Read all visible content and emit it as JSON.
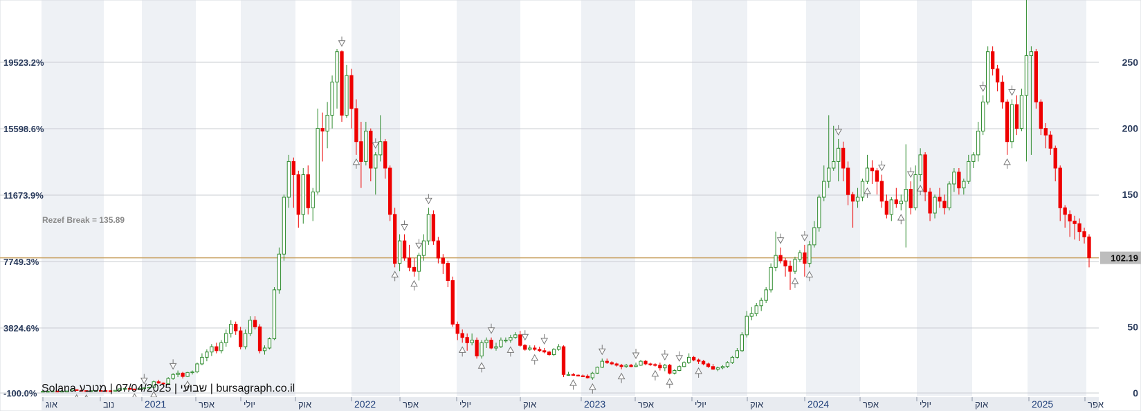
{
  "colors": {
    "up": "#2e8b2e",
    "down": "#ee0000",
    "price_line": "#c8a060",
    "grid": "#c9ccd2",
    "band": "#eef1f5",
    "axis_text": "#2a3b5c",
    "marker": "#777777",
    "price_box": "#bdbdbd"
  },
  "footer": "Solana שבועי | 07/04/2025 | מטבע | bursagraph.co.il",
  "annotation": "Rezef Break = 135.89",
  "last_price_label": "102.19",
  "chart_data": {
    "type": "candlestick",
    "title": "",
    "xlabel": "",
    "ylabel": "",
    "x_tick_labels": [
      "אוג",
      "נוב",
      "2021",
      "אפר",
      "יולי",
      "אוק",
      "2022",
      "אפר",
      "יולי",
      "אוק",
      "2023",
      "אפר",
      "יולי",
      "אוק",
      "2024",
      "אפר",
      "יולי",
      "אוק",
      "2025",
      "אפר"
    ],
    "left_axis_percent": [
      "19523.2%",
      "15598.6%",
      "11673.9%",
      "7749.3%",
      "3824.6%",
      "-100.0%"
    ],
    "right_axis_ticks": [
      "250",
      "200",
      "150",
      "50",
      "0"
    ],
    "ylim": [
      0,
      295
    ],
    "horizontal_line": 102.19,
    "grid": true,
    "candles": [
      [
        1.3,
        1.3,
        1.2,
        1.3
      ],
      [
        1.3,
        1.4,
        1.2,
        1.3
      ],
      [
        1.3,
        1.6,
        1.2,
        1.5
      ],
      [
        1.5,
        1.6,
        1.3,
        1.4
      ],
      [
        1.4,
        1.5,
        1.3,
        1.4
      ],
      [
        1.4,
        1.5,
        1.3,
        1.5
      ],
      [
        1.5,
        2.7,
        1.4,
        2.5
      ],
      [
        2.5,
        2.7,
        1.8,
        2.0
      ],
      [
        2.0,
        2.2,
        1.5,
        1.8
      ],
      [
        1.8,
        2.0,
        1.6,
        1.7
      ],
      [
        1.7,
        1.9,
        1.5,
        1.7
      ],
      [
        1.7,
        2.0,
        1.6,
        1.9
      ],
      [
        1.9,
        2.1,
        1.6,
        1.8
      ],
      [
        1.8,
        2.0,
        1.5,
        1.7
      ],
      [
        1.7,
        1.9,
        1.5,
        1.6
      ],
      [
        1.6,
        2.2,
        1.5,
        2.0
      ],
      [
        2.0,
        3.5,
        1.9,
        3.2
      ],
      [
        3.2,
        4.0,
        3.0,
        3.5
      ],
      [
        3.5,
        3.7,
        2.8,
        3.0
      ],
      [
        3.0,
        3.2,
        2.5,
        2.8
      ],
      [
        2.8,
        3.5,
        2.6,
        3.3
      ],
      [
        3.3,
        4.0,
        3.2,
        3.9
      ],
      [
        3.9,
        4.6,
        3.6,
        4.4
      ],
      [
        4.4,
        9.5,
        4.2,
        8.5
      ],
      [
        8.5,
        10.0,
        7.0,
        7.5
      ],
      [
        7.5,
        8.0,
        6.0,
        7.0
      ],
      [
        7.0,
        12.0,
        6.8,
        11.0
      ],
      [
        11.0,
        15.0,
        10.0,
        14.0
      ],
      [
        14.0,
        17.0,
        12.0,
        15.0
      ],
      [
        15.0,
        16.0,
        11.0,
        12.5
      ],
      [
        12.5,
        16.0,
        12.0,
        15.5
      ],
      [
        15.5,
        17.0,
        14.0,
        16.0
      ],
      [
        16.0,
        23.0,
        15.0,
        22.0
      ],
      [
        22.0,
        30.0,
        21.0,
        27.0
      ],
      [
        27.0,
        33.0,
        24.0,
        31.0
      ],
      [
        31.0,
        37.0,
        28.0,
        35.0
      ],
      [
        35.0,
        38.0,
        30.0,
        32.0
      ],
      [
        32.0,
        40.0,
        30.0,
        38.0
      ],
      [
        38.0,
        48.0,
        35.0,
        45.0
      ],
      [
        45.0,
        55.0,
        42.0,
        52.0
      ],
      [
        52.0,
        54.0,
        44.0,
        47.0
      ],
      [
        47.0,
        50.0,
        33.0,
        35.0
      ],
      [
        35.0,
        48.0,
        33.0,
        45.0
      ],
      [
        45.0,
        58.0,
        43.0,
        55.0
      ],
      [
        55.0,
        58.0,
        48.0,
        50.0
      ],
      [
        50.0,
        52.0,
        30.0,
        32.0
      ],
      [
        32.0,
        36.0,
        29.0,
        34.0
      ],
      [
        34.0,
        42.0,
        33.0,
        41.0
      ],
      [
        41.0,
        80.0,
        40.0,
        78.0
      ],
      [
        78.0,
        110.0,
        75.0,
        105.0
      ],
      [
        105.0,
        150.0,
        100.0,
        148.0
      ],
      [
        148.0,
        180.0,
        140.0,
        175.0
      ],
      [
        175.0,
        178.0,
        140.0,
        165.0
      ],
      [
        165.0,
        168.0,
        125.0,
        135.0
      ],
      [
        135.0,
        170.0,
        128.0,
        165.0
      ],
      [
        165.0,
        172.0,
        135.0,
        140.0
      ],
      [
        140.0,
        155.0,
        130.0,
        152.0
      ],
      [
        152.0,
        215.0,
        150.0,
        200.0
      ],
      [
        200.0,
        212.0,
        175.0,
        198.0
      ],
      [
        198.0,
        220.0,
        185.0,
        210.0
      ],
      [
        210.0,
        240.0,
        200.0,
        235.0
      ],
      [
        235.0,
        260.0,
        215.0,
        258.0
      ],
      [
        258.0,
        259.0,
        205.0,
        210.0
      ],
      [
        210.0,
        248.0,
        208.0,
        240.0
      ],
      [
        240.0,
        245.0,
        200.0,
        215.0
      ],
      [
        215.0,
        222.0,
        180.0,
        190.0
      ],
      [
        190.0,
        205.0,
        155.0,
        175.0
      ],
      [
        175.0,
        205.0,
        172.0,
        198.0
      ],
      [
        198.0,
        200.0,
        160.0,
        170.0
      ],
      [
        170.0,
        182.0,
        150.0,
        180.0
      ],
      [
        180.0,
        210.0,
        175.0,
        190.0
      ],
      [
        190.0,
        192.0,
        162.0,
        170.0
      ],
      [
        170.0,
        172.0,
        130.0,
        135.0
      ],
      [
        135.0,
        140.0,
        95.0,
        98.0
      ],
      [
        98.0,
        120.0,
        92.0,
        115.0
      ],
      [
        115.0,
        120.0,
        100.0,
        102.0
      ],
      [
        102.0,
        112.0,
        92.0,
        95.0
      ],
      [
        95.0,
        102.0,
        88.0,
        92.0
      ],
      [
        92.0,
        106.0,
        85.0,
        104.0
      ],
      [
        104.0,
        120.0,
        100.0,
        115.0
      ],
      [
        115.0,
        140.0,
        112.0,
        135.0
      ],
      [
        135.0,
        138.0,
        112.0,
        115.0
      ],
      [
        115.0,
        118.0,
        98.0,
        102.0
      ],
      [
        102.0,
        105.0,
        90.0,
        98.0
      ],
      [
        98.0,
        100.0,
        80.0,
        85.0
      ],
      [
        85.0,
        88.0,
        50.0,
        52.0
      ],
      [
        52.0,
        54.0,
        40.0,
        45.0
      ],
      [
        45.0,
        48.0,
        38.0,
        42.0
      ],
      [
        42.0,
        45.0,
        32.0,
        38.0
      ],
      [
        38.0,
        45.0,
        36.0,
        40.0
      ],
      [
        40.0,
        42.0,
        26.0,
        28.0
      ],
      [
        28.0,
        40.0,
        26.0,
        38.0
      ],
      [
        38.0,
        42.0,
        34.0,
        40.0
      ],
      [
        40.0,
        42.0,
        33.0,
        34.0
      ],
      [
        34.0,
        38.0,
        32.0,
        35.0
      ],
      [
        35.0,
        42.0,
        34.0,
        40.0
      ],
      [
        40.0,
        42.0,
        38.0,
        40.0
      ],
      [
        40.0,
        44.0,
        38.0,
        42.0
      ],
      [
        42.0,
        46.0,
        41.0,
        44.0
      ],
      [
        44.0,
        47.0,
        35.0,
        36.0
      ],
      [
        36.0,
        37.0,
        32.0,
        33.0
      ],
      [
        33.0,
        36.0,
        32.0,
        34.0
      ],
      [
        34.0,
        36.0,
        32.0,
        33.0
      ],
      [
        33.0,
        35.0,
        31.0,
        32.0
      ],
      [
        32.0,
        34.0,
        30.0,
        31.0
      ],
      [
        31.0,
        32.0,
        28.0,
        29.0
      ],
      [
        29.0,
        34.0,
        28.0,
        33.0
      ],
      [
        33.0,
        37.0,
        32.0,
        35.0
      ],
      [
        35.0,
        36.0,
        12.0,
        14.0
      ],
      [
        14.0,
        16.0,
        13.0,
        14.0
      ],
      [
        14.0,
        15.0,
        13.0,
        13.5
      ],
      [
        13.5,
        14.0,
        12.5,
        13.0
      ],
      [
        13.0,
        14.0,
        12.0,
        12.8
      ],
      [
        12.8,
        14.0,
        11.0,
        11.5
      ],
      [
        11.5,
        16.0,
        10.0,
        15.0
      ],
      [
        15.0,
        20.0,
        14.5,
        19.5
      ],
      [
        19.5,
        26.0,
        19.0,
        24.0
      ],
      [
        24.0,
        26.0,
        22.0,
        23.0
      ],
      [
        23.0,
        24.0,
        21.0,
        22.0
      ],
      [
        22.0,
        23.0,
        20.0,
        21.0
      ],
      [
        21.0,
        22.0,
        18.0,
        20.0
      ],
      [
        20.0,
        22.0,
        19.0,
        21.0
      ],
      [
        21.0,
        22.0,
        19.5,
        20.0
      ],
      [
        20.0,
        23.0,
        19.5,
        21.0
      ],
      [
        21.0,
        25.0,
        20.5,
        24.0
      ],
      [
        24.0,
        25.0,
        21.0,
        22.0
      ],
      [
        22.0,
        23.0,
        20.5,
        21.5
      ],
      [
        21.5,
        22.5,
        20.0,
        21.0
      ],
      [
        21.0,
        23.0,
        17.0,
        19.0
      ],
      [
        19.0,
        22.0,
        16.5,
        21.0
      ],
      [
        21.0,
        22.0,
        14.0,
        15.0
      ],
      [
        15.0,
        18.0,
        14.0,
        17.0
      ],
      [
        17.0,
        21.0,
        16.5,
        20.0
      ],
      [
        20.0,
        24.0,
        19.5,
        23.0
      ],
      [
        23.0,
        30.0,
        22.0,
        27.0
      ],
      [
        27.0,
        28.0,
        24.0,
        25.0
      ],
      [
        25.0,
        26.0,
        22.0,
        24.0
      ],
      [
        24.0,
        25.0,
        21.0,
        22.0
      ],
      [
        22.0,
        23.0,
        19.0,
        20.0
      ],
      [
        20.0,
        22.0,
        17.5,
        18.0
      ],
      [
        18.0,
        20.0,
        16.5,
        19.0
      ],
      [
        19.0,
        21.0,
        18.0,
        20.0
      ],
      [
        20.0,
        24.0,
        19.0,
        23.0
      ],
      [
        23.0,
        28.0,
        22.0,
        27.0
      ],
      [
        27.0,
        34.0,
        26.0,
        32.0
      ],
      [
        32.0,
        46.0,
        31.0,
        44.0
      ],
      [
        44.0,
        62.0,
        42.0,
        58.0
      ],
      [
        58.0,
        65.0,
        55.0,
        60.0
      ],
      [
        60.0,
        68.0,
        58.0,
        66.0
      ],
      [
        66.0,
        72.0,
        62.0,
        70.0
      ],
      [
        70.0,
        80.0,
        68.0,
        78.0
      ],
      [
        78.0,
        98.0,
        76.0,
        95.0
      ],
      [
        95.0,
        122.0,
        92.0,
        104.0
      ],
      [
        104.0,
        110.0,
        98.0,
        100.0
      ],
      [
        100.0,
        102.0,
        88.0,
        96.0
      ],
      [
        96.0,
        100.0,
        78.0,
        92.0
      ],
      [
        92.0,
        103.0,
        90.0,
        101.0
      ],
      [
        101.0,
        108.0,
        99.0,
        106.0
      ],
      [
        106.0,
        112.0,
        88.0,
        98.0
      ],
      [
        98.0,
        115.0,
        95.0,
        112.0
      ],
      [
        112.0,
        130.0,
        110.0,
        125.0
      ],
      [
        125.0,
        150.0,
        122.0,
        148.0
      ],
      [
        148.0,
        172.0,
        145.0,
        160.0
      ],
      [
        160.0,
        210.0,
        155.0,
        170.0
      ],
      [
        170.0,
        202.0,
        168.0,
        175.0
      ],
      [
        175.0,
        192.0,
        160.0,
        185.0
      ],
      [
        185.0,
        190.0,
        160.0,
        170.0
      ],
      [
        170.0,
        175.0,
        142.0,
        150.0
      ],
      [
        150.0,
        152.0,
        125.0,
        145.0
      ],
      [
        145.0,
        155.0,
        140.0,
        148.0
      ],
      [
        148.0,
        162.0,
        145.0,
        160.0
      ],
      [
        160.0,
        180.0,
        158.0,
        170.0
      ],
      [
        170.0,
        176.0,
        158.0,
        168.0
      ],
      [
        168.0,
        170.0,
        150.0,
        160.0
      ],
      [
        160.0,
        165.0,
        140.0,
        145.0
      ],
      [
        145.0,
        150.0,
        132.0,
        135.0
      ],
      [
        135.0,
        148.0,
        130.0,
        146.0
      ],
      [
        146.0,
        155.0,
        140.0,
        143.0
      ],
      [
        143.0,
        150.0,
        138.0,
        145.0
      ],
      [
        145.0,
        188.0,
        110.0,
        154.0
      ],
      [
        154.0,
        160.0,
        135.0,
        140.0
      ],
      [
        140.0,
        172.0,
        138.0,
        165.0
      ],
      [
        165.0,
        185.0,
        160.0,
        180.0
      ],
      [
        180.0,
        182.0,
        145.0,
        152.0
      ],
      [
        152.0,
        155.0,
        130.0,
        136.0
      ],
      [
        136.0,
        150.0,
        132.0,
        148.0
      ],
      [
        148.0,
        155.0,
        140.0,
        145.0
      ],
      [
        145.0,
        150.0,
        135.0,
        140.0
      ],
      [
        140.0,
        160.0,
        138.0,
        158.0
      ],
      [
        158.0,
        170.0,
        152.0,
        167.0
      ],
      [
        167.0,
        170.0,
        150.0,
        155.0
      ],
      [
        155.0,
        162.0,
        150.0,
        160.0
      ],
      [
        160.0,
        180.0,
        158.0,
        175.0
      ],
      [
        175.0,
        182.0,
        170.0,
        180.0
      ],
      [
        180.0,
        205.0,
        175.0,
        198.0
      ],
      [
        198.0,
        225.0,
        195.0,
        220.0
      ],
      [
        220.0,
        262.0,
        218.0,
        258.0
      ],
      [
        258.0,
        262.0,
        240.0,
        245.0
      ],
      [
        245.0,
        248.0,
        228.0,
        235.0
      ],
      [
        235.0,
        240.0,
        215.0,
        220.0
      ],
      [
        220.0,
        222.0,
        180.0,
        190.0
      ],
      [
        190.0,
        222.0,
        185.0,
        218.0
      ],
      [
        218.0,
        225.0,
        195.0,
        200.0
      ],
      [
        200.0,
        230.0,
        198.0,
        225.0
      ],
      [
        225.0,
        300.0,
        175.0,
        255.0
      ],
      [
        255.0,
        262.0,
        180.0,
        258.0
      ],
      [
        258.0,
        260.0,
        215.0,
        220.0
      ],
      [
        220.0,
        222.0,
        195.0,
        200.0
      ],
      [
        200.0,
        204.0,
        185.0,
        195.0
      ],
      [
        195.0,
        198.0,
        180.0,
        185.0
      ],
      [
        185.0,
        187.0,
        160.0,
        170.0
      ],
      [
        170.0,
        172.0,
        130.0,
        140.0
      ],
      [
        140.0,
        142.0,
        125.0,
        135.0
      ],
      [
        135.0,
        138.0,
        118.0,
        130.0
      ],
      [
        130.0,
        134.0,
        116.0,
        128.0
      ],
      [
        128.0,
        132.0,
        115.0,
        122.0
      ],
      [
        122.0,
        125.0,
        113.0,
        118.0
      ],
      [
        118.0,
        120.0,
        95.0,
        102.19
      ]
    ],
    "markers": [
      {
        "candle": 7,
        "dir": "up"
      },
      {
        "candle": 9,
        "dir": "up"
      },
      {
        "candle": 19,
        "dir": "up"
      },
      {
        "candle": 21,
        "dir": "down"
      },
      {
        "candle": 23,
        "dir": "up"
      },
      {
        "candle": 27,
        "dir": "down"
      },
      {
        "candle": 30,
        "dir": "up"
      },
      {
        "candle": 62,
        "dir": "down"
      },
      {
        "candle": 65,
        "dir": "up"
      },
      {
        "candle": 69,
        "dir": "down"
      },
      {
        "candle": 73,
        "dir": "up"
      },
      {
        "candle": 75,
        "dir": "down"
      },
      {
        "candle": 77,
        "dir": "up"
      },
      {
        "candle": 78,
        "dir": "down"
      },
      {
        "candle": 80,
        "dir": "down"
      },
      {
        "candle": 87,
        "dir": "up"
      },
      {
        "candle": 91,
        "dir": "up"
      },
      {
        "candle": 93,
        "dir": "down"
      },
      {
        "candle": 97,
        "dir": "up"
      },
      {
        "candle": 100,
        "dir": "down"
      },
      {
        "candle": 102,
        "dir": "up"
      },
      {
        "candle": 104,
        "dir": "down"
      },
      {
        "candle": 110,
        "dir": "up"
      },
      {
        "candle": 114,
        "dir": "up"
      },
      {
        "candle": 116,
        "dir": "down"
      },
      {
        "candle": 120,
        "dir": "up"
      },
      {
        "candle": 123,
        "dir": "down"
      },
      {
        "candle": 127,
        "dir": "up"
      },
      {
        "candle": 129,
        "dir": "down"
      },
      {
        "candle": 130,
        "dir": "up"
      },
      {
        "candle": 132,
        "dir": "down"
      },
      {
        "candle": 136,
        "dir": "up"
      },
      {
        "candle": 153,
        "dir": "down"
      },
      {
        "candle": 156,
        "dir": "up"
      },
      {
        "candle": 158,
        "dir": "down"
      },
      {
        "candle": 159,
        "dir": "up"
      },
      {
        "candle": 165,
        "dir": "down"
      },
      {
        "candle": 171,
        "dir": "up"
      },
      {
        "candle": 174,
        "dir": "down"
      },
      {
        "candle": 178,
        "dir": "up"
      },
      {
        "candle": 180,
        "dir": "down"
      },
      {
        "candle": 182,
        "dir": "up"
      },
      {
        "candle": 195,
        "dir": "down"
      },
      {
        "candle": 200,
        "dir": "up"
      },
      {
        "candle": 201,
        "dir": "down"
      }
    ]
  }
}
